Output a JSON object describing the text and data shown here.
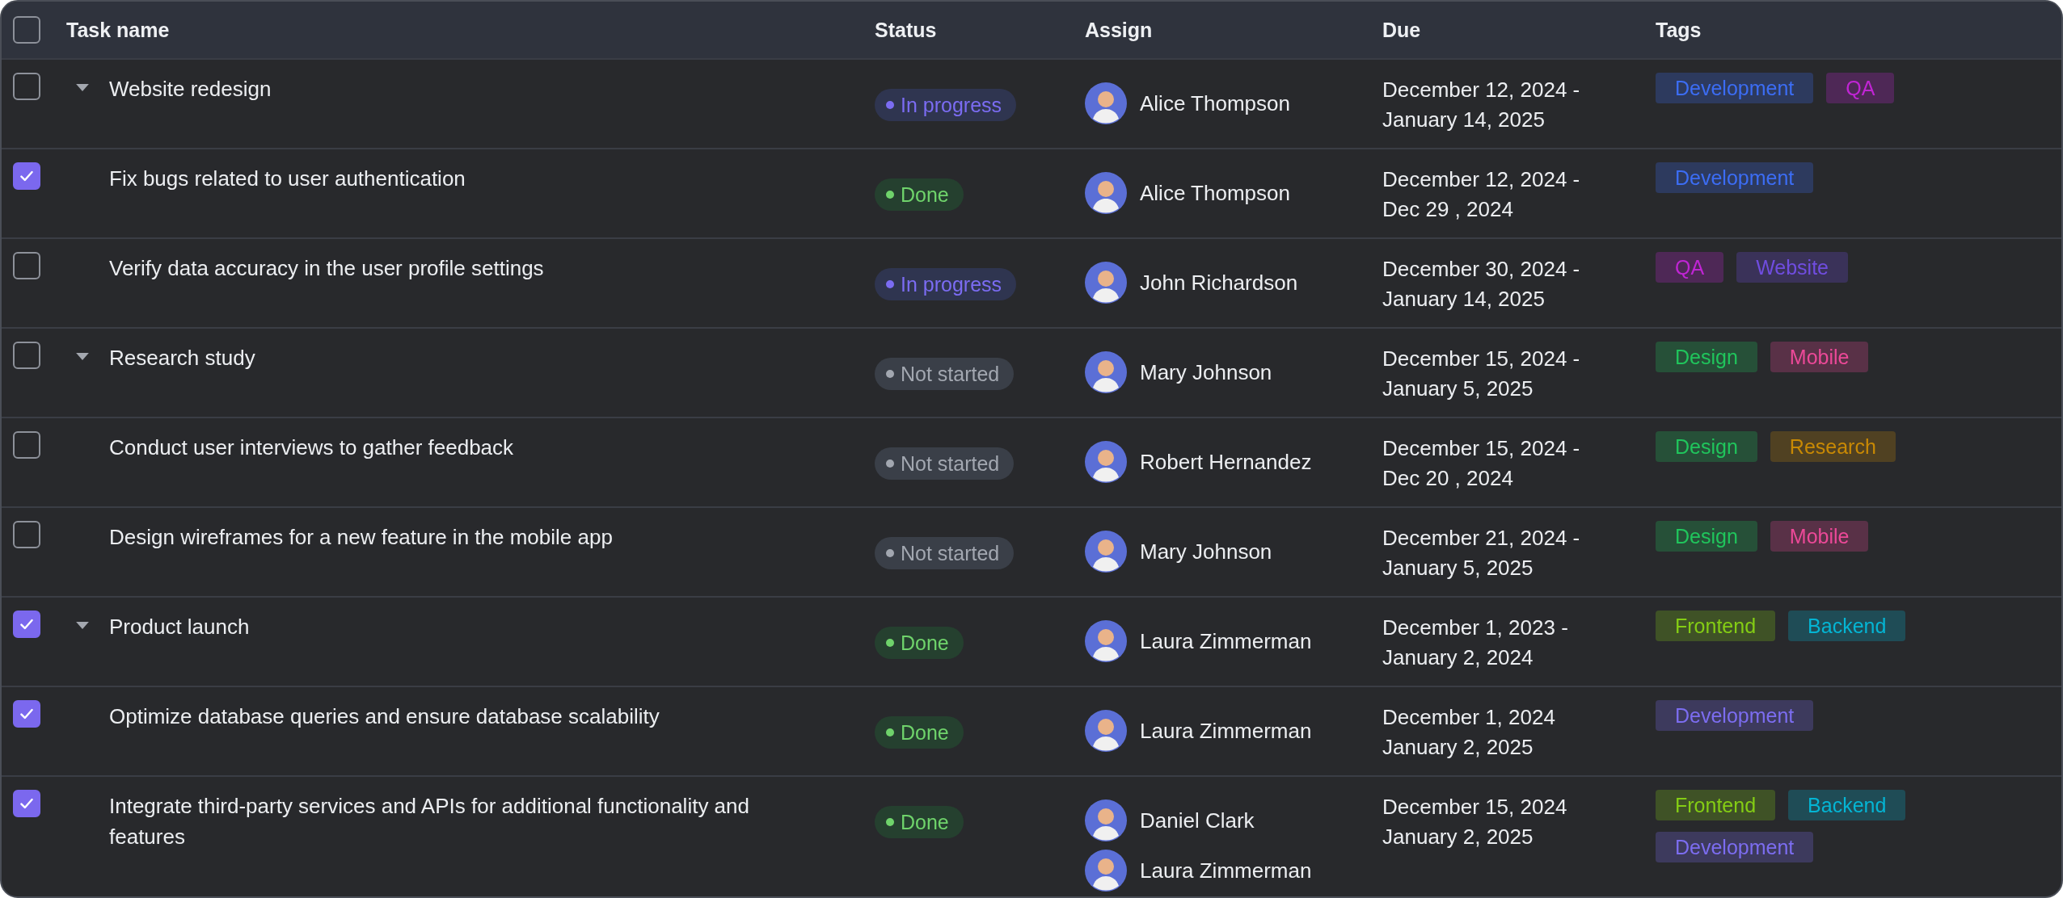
{
  "header": {
    "checked": false,
    "columns": [
      "Task name",
      "Status",
      "Assign",
      "Due",
      "Tags"
    ]
  },
  "rows": [
    {
      "name": "Website redesign",
      "checked": false,
      "expanded": true,
      "status": {
        "kind": "in_progress",
        "label": "In progress"
      },
      "assignees": [
        {
          "name": "Alice Thompson"
        }
      ],
      "due": [
        "December 12, 2024 -",
        "January 14, 2025"
      ],
      "tags": [
        {
          "label": "Development",
          "color": "#2d3a5e"
        },
        {
          "label": "QA",
          "color": "#4e2856"
        }
      ],
      "children": [
        {
          "name": "Fix bugs related to user authentication",
          "checked": true,
          "status": {
            "kind": "done",
            "label": "Done"
          },
          "assignees": [
            {
              "name": "Alice Thompson"
            }
          ],
          "due": [
            "December 12, 2024 -",
            "Dec 29 , 2024"
          ],
          "tags": [
            {
              "label": "Development",
              "color": "#2d3a5e"
            }
          ]
        },
        {
          "name": "Verify data accuracy in the user profile settings",
          "checked": false,
          "status": {
            "kind": "in_progress",
            "label": "In progress"
          },
          "assignees": [
            {
              "name": "John Richardson"
            }
          ],
          "due": [
            "December 30, 2024 -",
            "January 14, 2025"
          ],
          "tags": [
            {
              "label": "QA",
              "color": "#4e2856"
            },
            {
              "label": "Website",
              "color": "#3a3259"
            }
          ]
        }
      ]
    },
    {
      "name": "Research study",
      "checked": false,
      "expanded": true,
      "status": {
        "kind": "not_started",
        "label": "Not started"
      },
      "assignees": [
        {
          "name": "Mary Johnson"
        }
      ],
      "due": [
        "December 15, 2024 -",
        "January 5, 2025"
      ],
      "tags": [
        {
          "label": "Design",
          "color": "#265038"
        },
        {
          "label": "Mobile",
          "color": "#593147"
        }
      ],
      "children": [
        {
          "name": "Conduct user interviews to gather feedback",
          "checked": false,
          "status": {
            "kind": "not_started",
            "label": "Not started"
          },
          "assignees": [
            {
              "name": "Robert Hernandez"
            }
          ],
          "due": [
            "December 15, 2024 -",
            "Dec 20 , 2024"
          ],
          "tags": [
            {
              "label": "Design",
              "color": "#265038"
            },
            {
              "label": "Research",
              "color": "#504122"
            }
          ]
        },
        {
          "name": "Design wireframes for a new feature in the mobile app",
          "checked": false,
          "status": {
            "kind": "not_started",
            "label": "Not started"
          },
          "assignees": [
            {
              "name": "Mary Johnson"
            }
          ],
          "due": [
            "December 21, 2024 -",
            "January 5, 2025"
          ],
          "tags": [
            {
              "label": "Design",
              "color": "#265038"
            },
            {
              "label": "Mobile",
              "color": "#593147"
            }
          ]
        }
      ]
    },
    {
      "name": "Product launch",
      "checked": true,
      "expanded": true,
      "status": {
        "kind": "done",
        "label": "Done"
      },
      "assignees": [
        {
          "name": "Laura Zimmerman"
        }
      ],
      "due": [
        "December 1, 2023 -",
        "January 2, 2024"
      ],
      "tags": [
        {
          "label": "Frontend",
          "color": "#3f5226"
        },
        {
          "label": "Backend",
          "color": "#1f4c56"
        }
      ],
      "children": [
        {
          "name": "Optimize database queries and ensure database scalability",
          "checked": true,
          "status": {
            "kind": "done",
            "label": "Done"
          },
          "assignees": [
            {
              "name": "Laura Zimmerman"
            }
          ],
          "due": [
            "December 1, 2024",
            "January 2, 2025"
          ],
          "tags": [
            {
              "label": "Development",
              "color": "#3d3a5d"
            }
          ]
        },
        {
          "name": "Integrate third-party services and APIs for additional functionality and features",
          "checked": true,
          "status": {
            "kind": "done",
            "label": "Done"
          },
          "assignees": [
            {
              "name": "Daniel Clark"
            },
            {
              "name": "Laura Zimmerman"
            }
          ],
          "due": [
            "December 15, 2024",
            "January 2, 2025"
          ],
          "tags": [
            {
              "label": "Frontend",
              "color": "#3f5226"
            },
            {
              "label": "Backend",
              "color": "#1f4c56"
            },
            {
              "label": "Development",
              "color": "#3d3a5d"
            }
          ]
        }
      ]
    }
  ]
}
